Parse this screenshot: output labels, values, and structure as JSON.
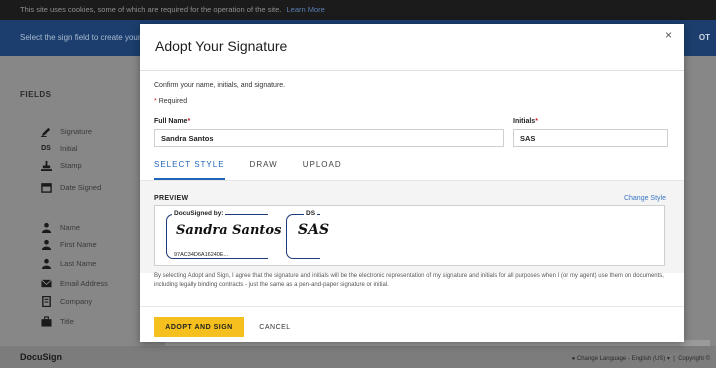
{
  "background": {
    "cookie_bar": {
      "text": "This site uses cookies, some of which are required for the operation of the site.",
      "link": "Learn More"
    },
    "topbar": {
      "instruction": "Select the sign field to create your signature",
      "right_text": "OT"
    },
    "sidebar": {
      "title": "FIELDS",
      "items": [
        {
          "label": "Signature",
          "icon": "pen-icon"
        },
        {
          "label": "Initial",
          "icon": "initial-icon"
        },
        {
          "label": "Stamp",
          "icon": "stamp-icon"
        },
        {
          "label": "Date Signed",
          "icon": "calendar-icon"
        },
        {
          "label": "Name",
          "icon": "person-icon"
        },
        {
          "label": "First Name",
          "icon": "person-icon"
        },
        {
          "label": "Last Name",
          "icon": "person-icon"
        },
        {
          "label": "Email Address",
          "icon": "envelope-icon"
        },
        {
          "label": "Company",
          "icon": "building-icon"
        },
        {
          "label": "Title",
          "icon": "briefcase-icon"
        }
      ]
    },
    "brand": "DocuSign",
    "footer": {
      "change_language": "Change Language - English (US)",
      "copyright": "Copyright ©"
    }
  },
  "modal": {
    "title": "Adopt Your Signature",
    "close_label": "×",
    "intro": "Confirm your name, initials, and signature.",
    "required_note": "Required",
    "full_name": {
      "label": "Full Name",
      "value": "Sandra Santos"
    },
    "initials": {
      "label": "Initials",
      "value": "SAS"
    },
    "tabs": [
      {
        "label": "SELECT STYLE",
        "active": true
      },
      {
        "label": "DRAW",
        "active": false
      },
      {
        "label": "UPLOAD",
        "active": false
      }
    ],
    "preview": {
      "label": "PREVIEW",
      "change_style": "Change Style",
      "signature_header": "DocuSigned by:",
      "signature_text": "Sandra Santos",
      "signature_code": "97AC34D6A16240E...",
      "initials_header": "DS",
      "initials_text": "SAS"
    },
    "legal": "By selecting Adopt and Sign, I agree that the signature and initials will be the electronic representation of my signature and initials for all purposes when I (or my agent) use them on documents, including legally binding contracts - just the same as a pen-and-paper signature or initial.",
    "adopt_button": "ADOPT AND SIGN",
    "cancel_button": "CANCEL"
  },
  "colors": {
    "accent": "#1f65b9",
    "primary_button": "#f5c01d",
    "signature_frame": "#1d3b78",
    "required_star": "#c62828"
  }
}
